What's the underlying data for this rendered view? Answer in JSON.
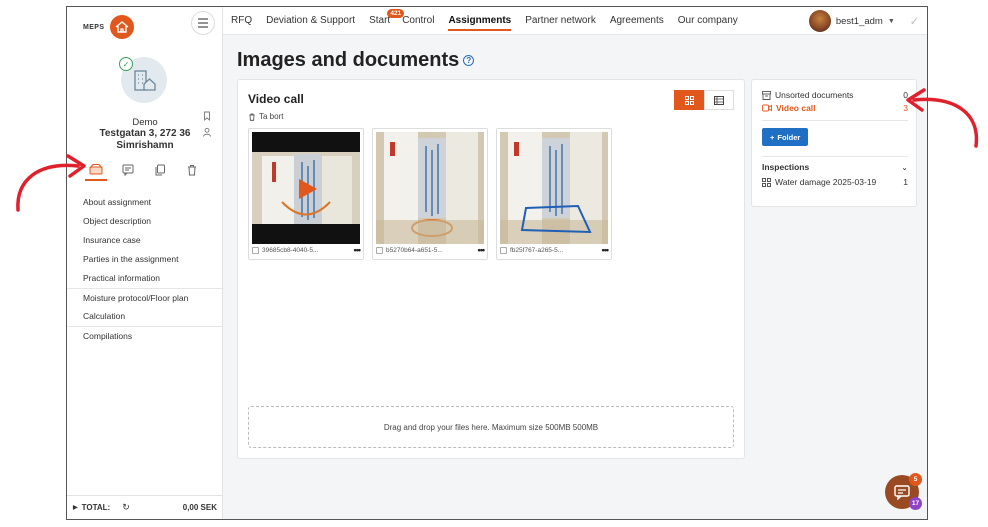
{
  "brand": {
    "name": "MEPS"
  },
  "property": {
    "name": "Demo",
    "address": "Testgatan 3, 272 36 Simrishamn"
  },
  "sidebar": {
    "tabs": [
      {
        "icon": "house-folder-icon",
        "active": true
      },
      {
        "icon": "chat-icon",
        "active": false
      },
      {
        "icon": "copy-icon",
        "active": false
      },
      {
        "icon": "trash-icon",
        "active": false
      }
    ],
    "items": [
      {
        "label": "About assignment"
      },
      {
        "label": "Object description"
      },
      {
        "label": "Insurance case"
      },
      {
        "label": "Parties in the assignment"
      },
      {
        "label": "Practical information"
      },
      {
        "label": "Moisture protocol/Floor plan"
      },
      {
        "label": "Calculation"
      },
      {
        "label": "Compilations"
      }
    ],
    "total_label": "TOTAL:",
    "total_amount": "0,00 SEK"
  },
  "topnav": {
    "items": [
      {
        "label": "RFQ"
      },
      {
        "label": "Deviation & Support"
      },
      {
        "label": "Start",
        "badge": "421"
      },
      {
        "label": "Control"
      },
      {
        "label": "Assignments",
        "active": true
      },
      {
        "label": "Partner network"
      },
      {
        "label": "Agreements"
      },
      {
        "label": "Our company"
      }
    ],
    "user": "best1_adm"
  },
  "page": {
    "title": "Images and documents"
  },
  "folder_view": {
    "title": "Video call",
    "delete_label": "Ta bort",
    "files": [
      {
        "name": "39685cb8-4040-5...",
        "type": "video"
      },
      {
        "name": "b5270b64-a651-5...",
        "type": "image"
      },
      {
        "name": "fb25f767-a265-5...",
        "type": "image"
      }
    ],
    "drop_text": "Drag and drop your files here. Maximum size 500MB 500MB"
  },
  "folders_panel": {
    "unsorted_label": "Unsorted documents",
    "unsorted_count": "0",
    "video_label": "Video call",
    "video_count": "3",
    "folder_button": "Folder",
    "inspections_label": "Inspections",
    "inspection_item": "Water damage 2025-03-19",
    "inspection_count": "1"
  },
  "chat": {
    "badge_top": "5",
    "badge_bottom": "17"
  },
  "colors": {
    "accent": "#e2571b",
    "primary_button": "#1f6fc5",
    "annotation_arrow": "#e0202a"
  }
}
